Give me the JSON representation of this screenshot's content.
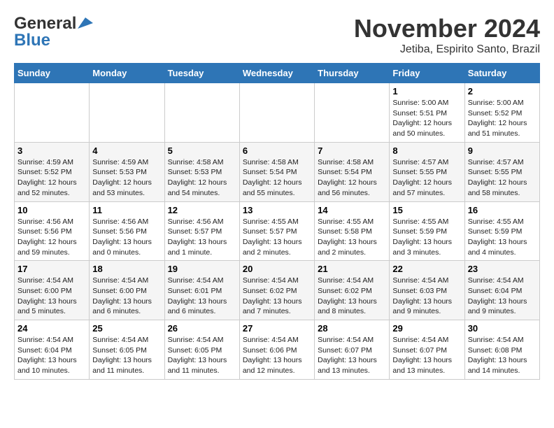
{
  "logo": {
    "line1": "General",
    "line2": "Blue"
  },
  "title": "November 2024",
  "subtitle": "Jetiba, Espirito Santo, Brazil",
  "headers": [
    "Sunday",
    "Monday",
    "Tuesday",
    "Wednesday",
    "Thursday",
    "Friday",
    "Saturday"
  ],
  "weeks": [
    [
      {
        "day": "",
        "info": ""
      },
      {
        "day": "",
        "info": ""
      },
      {
        "day": "",
        "info": ""
      },
      {
        "day": "",
        "info": ""
      },
      {
        "day": "",
        "info": ""
      },
      {
        "day": "1",
        "info": "Sunrise: 5:00 AM\nSunset: 5:51 PM\nDaylight: 12 hours\nand 50 minutes."
      },
      {
        "day": "2",
        "info": "Sunrise: 5:00 AM\nSunset: 5:52 PM\nDaylight: 12 hours\nand 51 minutes."
      }
    ],
    [
      {
        "day": "3",
        "info": "Sunrise: 4:59 AM\nSunset: 5:52 PM\nDaylight: 12 hours\nand 52 minutes."
      },
      {
        "day": "4",
        "info": "Sunrise: 4:59 AM\nSunset: 5:53 PM\nDaylight: 12 hours\nand 53 minutes."
      },
      {
        "day": "5",
        "info": "Sunrise: 4:58 AM\nSunset: 5:53 PM\nDaylight: 12 hours\nand 54 minutes."
      },
      {
        "day": "6",
        "info": "Sunrise: 4:58 AM\nSunset: 5:54 PM\nDaylight: 12 hours\nand 55 minutes."
      },
      {
        "day": "7",
        "info": "Sunrise: 4:58 AM\nSunset: 5:54 PM\nDaylight: 12 hours\nand 56 minutes."
      },
      {
        "day": "8",
        "info": "Sunrise: 4:57 AM\nSunset: 5:55 PM\nDaylight: 12 hours\nand 57 minutes."
      },
      {
        "day": "9",
        "info": "Sunrise: 4:57 AM\nSunset: 5:55 PM\nDaylight: 12 hours\nand 58 minutes."
      }
    ],
    [
      {
        "day": "10",
        "info": "Sunrise: 4:56 AM\nSunset: 5:56 PM\nDaylight: 12 hours\nand 59 minutes."
      },
      {
        "day": "11",
        "info": "Sunrise: 4:56 AM\nSunset: 5:56 PM\nDaylight: 13 hours\nand 0 minutes."
      },
      {
        "day": "12",
        "info": "Sunrise: 4:56 AM\nSunset: 5:57 PM\nDaylight: 13 hours\nand 1 minute."
      },
      {
        "day": "13",
        "info": "Sunrise: 4:55 AM\nSunset: 5:57 PM\nDaylight: 13 hours\nand 2 minutes."
      },
      {
        "day": "14",
        "info": "Sunrise: 4:55 AM\nSunset: 5:58 PM\nDaylight: 13 hours\nand 2 minutes."
      },
      {
        "day": "15",
        "info": "Sunrise: 4:55 AM\nSunset: 5:59 PM\nDaylight: 13 hours\nand 3 minutes."
      },
      {
        "day": "16",
        "info": "Sunrise: 4:55 AM\nSunset: 5:59 PM\nDaylight: 13 hours\nand 4 minutes."
      }
    ],
    [
      {
        "day": "17",
        "info": "Sunrise: 4:54 AM\nSunset: 6:00 PM\nDaylight: 13 hours\nand 5 minutes."
      },
      {
        "day": "18",
        "info": "Sunrise: 4:54 AM\nSunset: 6:00 PM\nDaylight: 13 hours\nand 6 minutes."
      },
      {
        "day": "19",
        "info": "Sunrise: 4:54 AM\nSunset: 6:01 PM\nDaylight: 13 hours\nand 6 minutes."
      },
      {
        "day": "20",
        "info": "Sunrise: 4:54 AM\nSunset: 6:02 PM\nDaylight: 13 hours\nand 7 minutes."
      },
      {
        "day": "21",
        "info": "Sunrise: 4:54 AM\nSunset: 6:02 PM\nDaylight: 13 hours\nand 8 minutes."
      },
      {
        "day": "22",
        "info": "Sunrise: 4:54 AM\nSunset: 6:03 PM\nDaylight: 13 hours\nand 9 minutes."
      },
      {
        "day": "23",
        "info": "Sunrise: 4:54 AM\nSunset: 6:04 PM\nDaylight: 13 hours\nand 9 minutes."
      }
    ],
    [
      {
        "day": "24",
        "info": "Sunrise: 4:54 AM\nSunset: 6:04 PM\nDaylight: 13 hours\nand 10 minutes."
      },
      {
        "day": "25",
        "info": "Sunrise: 4:54 AM\nSunset: 6:05 PM\nDaylight: 13 hours\nand 11 minutes."
      },
      {
        "day": "26",
        "info": "Sunrise: 4:54 AM\nSunset: 6:05 PM\nDaylight: 13 hours\nand 11 minutes."
      },
      {
        "day": "27",
        "info": "Sunrise: 4:54 AM\nSunset: 6:06 PM\nDaylight: 13 hours\nand 12 minutes."
      },
      {
        "day": "28",
        "info": "Sunrise: 4:54 AM\nSunset: 6:07 PM\nDaylight: 13 hours\nand 13 minutes."
      },
      {
        "day": "29",
        "info": "Sunrise: 4:54 AM\nSunset: 6:07 PM\nDaylight: 13 hours\nand 13 minutes."
      },
      {
        "day": "30",
        "info": "Sunrise: 4:54 AM\nSunset: 6:08 PM\nDaylight: 13 hours\nand 14 minutes."
      }
    ]
  ]
}
